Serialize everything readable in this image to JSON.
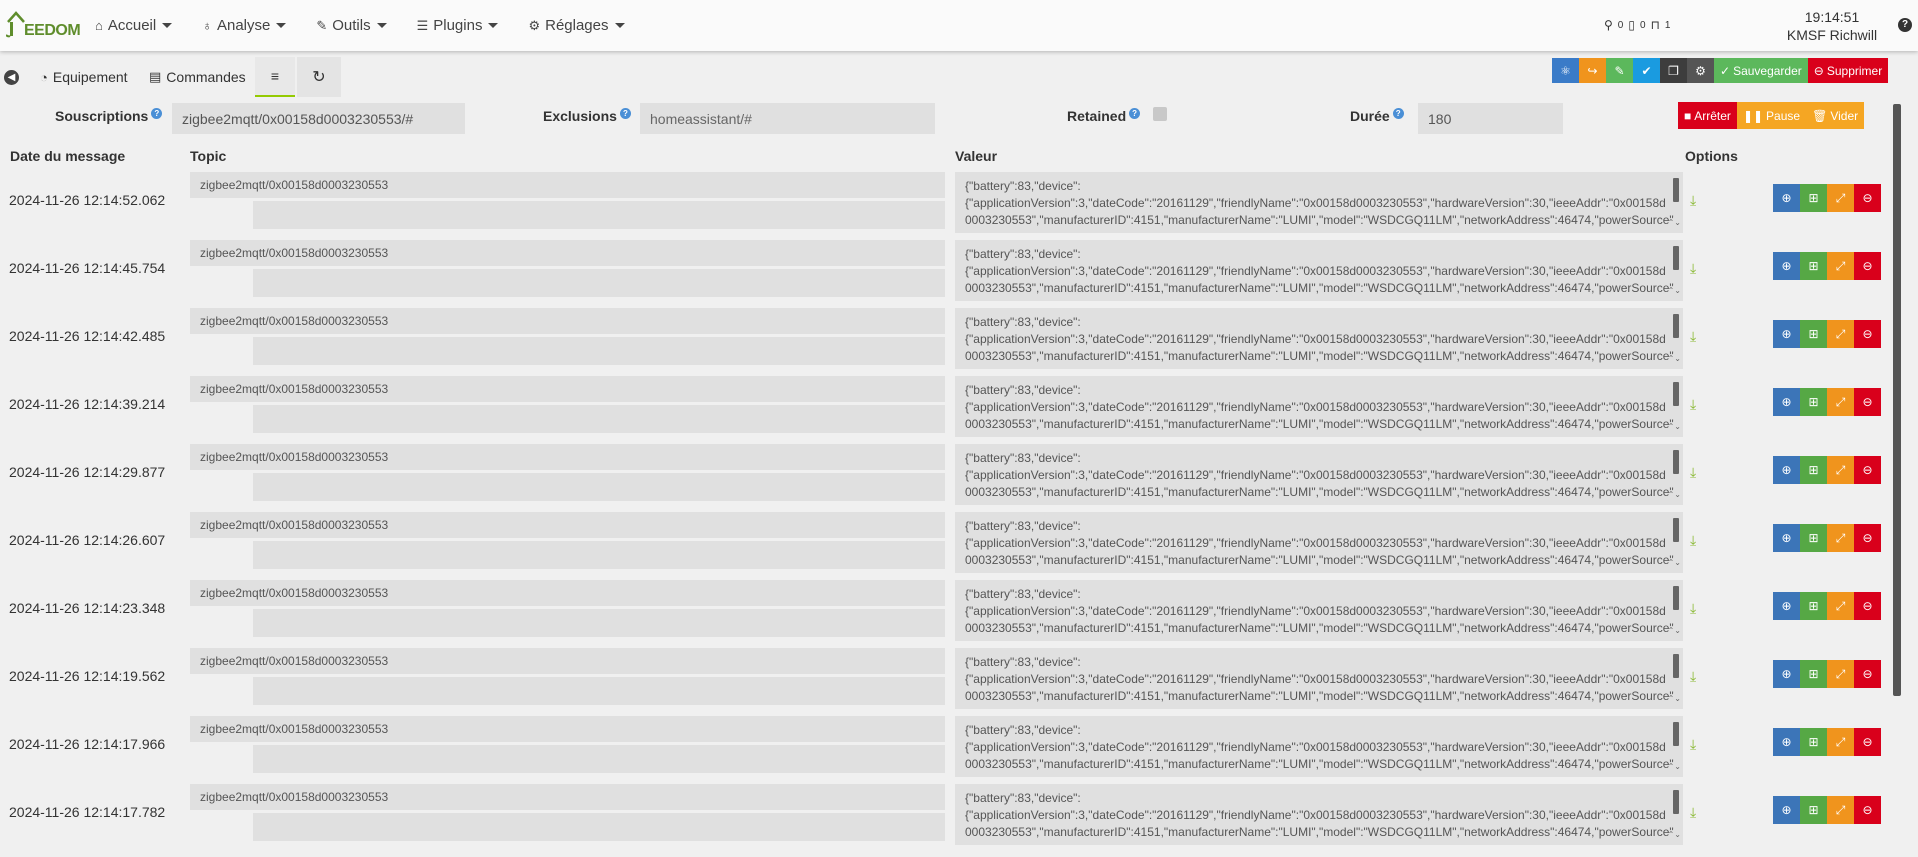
{
  "nav": {
    "logo": "EEDOM",
    "menu": [
      {
        "label": "Accueil",
        "icon": "home-icon"
      },
      {
        "label": "Analyse",
        "icon": "stethoscope-icon"
      },
      {
        "label": "Outils",
        "icon": "wrench-icon"
      },
      {
        "label": "Plugins",
        "icon": "tasks-icon"
      },
      {
        "label": "Réglages",
        "icon": "cog-icon"
      }
    ],
    "indicators": [
      "0",
      "0",
      "1"
    ],
    "time": "19:14:51",
    "user": "KMSF Richwill"
  },
  "tabs": {
    "equipement": "Equipement",
    "commandes": "Commandes"
  },
  "actions": {
    "save": "Sauvegarder",
    "delete": "Supprimer"
  },
  "filters": {
    "subscriptions_label": "Souscriptions",
    "subscriptions_value": "zigbee2mqtt/0x00158d0003230553/#",
    "exclusions_label": "Exclusions",
    "exclusions_placeholder": "homeassistant/#",
    "retained_label": "Retained",
    "duration_label": "Durée",
    "duration_value": "180",
    "stop": "Arrêter",
    "pause": "Pause",
    "clear": "Vider"
  },
  "table": {
    "headers": [
      "Date du message",
      "Topic",
      "Valeur",
      "Options"
    ],
    "rows": [
      {
        "date": "2024-11-26 12:14:52.062",
        "topic": "zigbee2mqtt/0x00158d0003230553"
      },
      {
        "date": "2024-11-26 12:14:45.754",
        "topic": "zigbee2mqtt/0x00158d0003230553"
      },
      {
        "date": "2024-11-26 12:14:42.485",
        "topic": "zigbee2mqtt/0x00158d0003230553"
      },
      {
        "date": "2024-11-26 12:14:39.214",
        "topic": "zigbee2mqtt/0x00158d0003230553"
      },
      {
        "date": "2024-11-26 12:14:29.877",
        "topic": "zigbee2mqtt/0x00158d0003230553"
      },
      {
        "date": "2024-11-26 12:14:26.607",
        "topic": "zigbee2mqtt/0x00158d0003230553"
      },
      {
        "date": "2024-11-26 12:14:23.348",
        "topic": "zigbee2mqtt/0x00158d0003230553"
      },
      {
        "date": "2024-11-26 12:14:19.562",
        "topic": "zigbee2mqtt/0x00158d0003230553"
      },
      {
        "date": "2024-11-26 12:14:17.966",
        "topic": "zigbee2mqtt/0x00158d0003230553"
      },
      {
        "date": "2024-11-26 12:14:17.782",
        "topic": "zigbee2mqtt/0x00158d0003230553"
      }
    ],
    "value_line1": "{\"battery\":83,\"device\":",
    "value_line2": "{\"applicationVersion\":3,\"dateCode\":\"20161129\",\"friendlyName\":\"0x00158d0003230553\",\"hardwareVersion\":30,\"ieeeAddr\":\"0x00158d",
    "value_line3": "0003230553\",\"manufacturerID\":4151,\"manufacturerName\":\"LUMI\",\"model\":\"WSDCGQ11LM\",\"networkAddress\":46474,\"powerSource\""
  },
  "colors": {
    "accent": "#94ca02",
    "save": "#5cb85c",
    "delete": "#d9001b",
    "pause": "#f5a623"
  }
}
